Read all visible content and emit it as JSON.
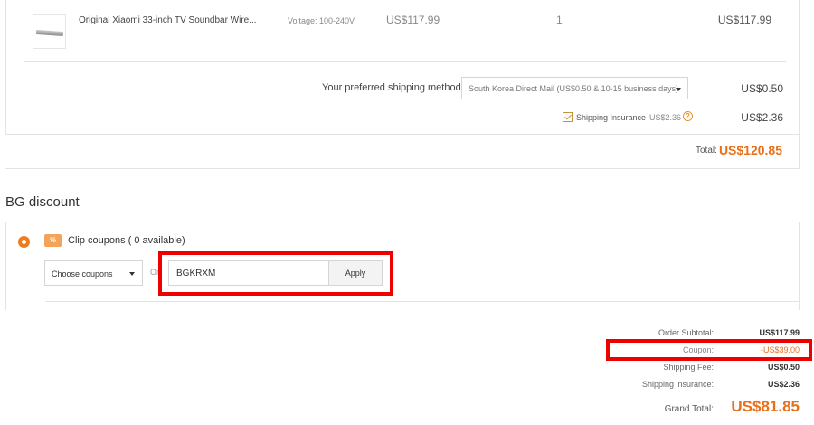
{
  "cart_item": {
    "name": "Original Xiaomi 33-inch TV Soundbar Wire...",
    "option": "Voltage: 100-240V",
    "unit_price": "US$117.99",
    "quantity": "1",
    "line_total": "US$117.99"
  },
  "shipping": {
    "label": "Your preferred shipping method:",
    "selected": "South Korea Direct Mail (US$0.50 & 10-15 business days)",
    "fee": "US$0.50"
  },
  "insurance": {
    "checked": true,
    "label": "Shipping Insurance",
    "price": "US$2.36",
    "help_icon": "question-icon",
    "fee": "US$2.36"
  },
  "total": {
    "label": "Total:",
    "value": "US$120.85"
  },
  "discount": {
    "title": "BG discount",
    "clip_label": "Clip coupons ( 0 available)",
    "coupon_icon_text": "%",
    "choose_placeholder": "Choose coupons",
    "or_text": "Or",
    "coupon_code": "BGKRXM",
    "apply_label": "Apply"
  },
  "summary": {
    "order_subtotal_label": "Order Subtotal:",
    "order_subtotal_value": "US$117.99",
    "coupon_label": "Coupon:",
    "coupon_value": "-US$39.00",
    "shipping_fee_label": "Shipping Fee:",
    "shipping_fee_value": "US$0.50",
    "shipping_insurance_label": "Shipping insurance:",
    "shipping_insurance_value": "US$2.36",
    "grand_total_label": "Grand Total:",
    "grand_total_value": "US$81.85"
  },
  "colors": {
    "accent": "#e8701a",
    "highlight": "#ee0000"
  }
}
